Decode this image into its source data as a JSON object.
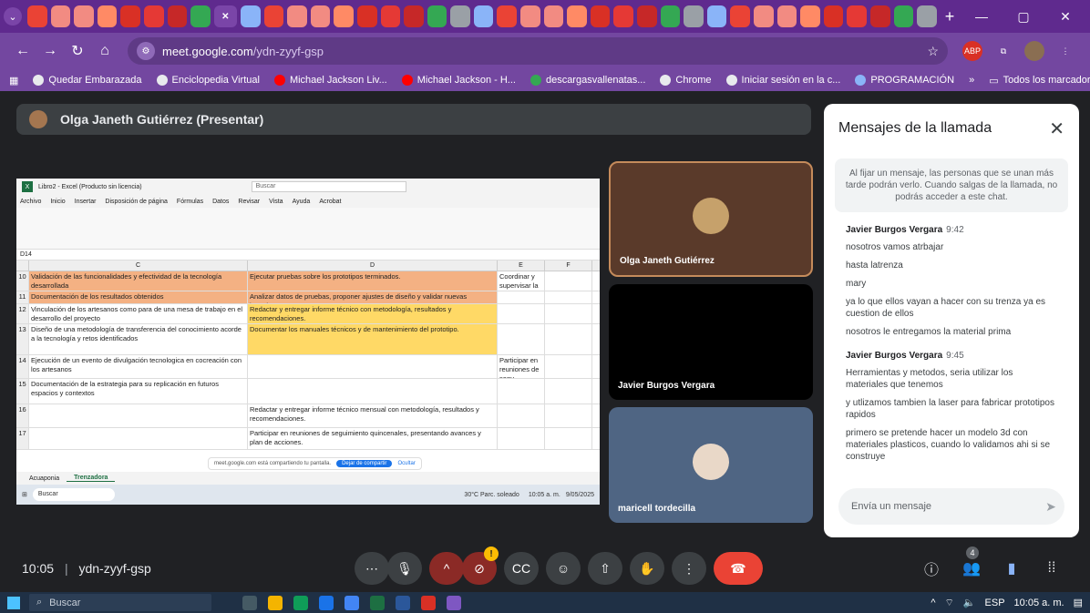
{
  "browser": {
    "url_host": "meet.google.com",
    "url_path": "/ydn-zyyf-gsp",
    "tab_icons": [
      "gmail-icon",
      "arrow-icon",
      "arrow-icon",
      "bookmark-icon",
      "app-icon",
      "pill-icon",
      "youtube-icon",
      "whatsapp-icon",
      "close-icon",
      "chrome-icon",
      "chrome-icon",
      "chrome-icon",
      "meet-icon",
      "chrome-icon",
      "meet-icon",
      "meet-icon",
      "chrome-icon",
      "pen-icon",
      "youtube-icon",
      "puzzle-icon",
      "pen-icon",
      "pen-icon",
      "link-icon",
      "chrome-icon",
      "app-icon",
      "app-icon",
      "app-icon",
      "app-icon",
      "app-icon",
      "chrome-icon",
      "app-icon",
      "app-icon",
      "chrome-icon",
      "heart-icon",
      "chrome-icon",
      "chrome-icon",
      "app-icon",
      "app-icon",
      "chrome-icon"
    ],
    "new_tab": "+",
    "bookmarks": [
      {
        "label": "Quedar Embarazada",
        "color": "#e8eaed"
      },
      {
        "label": "Enciclopedia Virtual",
        "color": "#e8eaed"
      },
      {
        "label": "Michael Jackson Liv...",
        "color": "#ff0000"
      },
      {
        "label": "Michael Jackson - H...",
        "color": "#ff0000"
      },
      {
        "label": "descargasvallenatas...",
        "color": "#34a853"
      },
      {
        "label": "Chrome",
        "color": "#e8eaed"
      },
      {
        "label": "Iniciar sesión en la c...",
        "color": "#e8eaed"
      },
      {
        "label": "PROGRAMACIÓN",
        "color": "#8ab4f8"
      }
    ],
    "bookmarks_more": "»",
    "all_bookmarks": "Todos los marcadores"
  },
  "presenter": {
    "label": "Olga Janeth Gutiérrez (Presentar)"
  },
  "excel": {
    "title": "Libro2 - Excel (Producto sin licencia)",
    "search": "Buscar",
    "menu": [
      "Archivo",
      "Inicio",
      "Insertar",
      "Disposición de página",
      "Fórmulas",
      "Datos",
      "Revisar",
      "Vista",
      "Ayuda",
      "Acrobat"
    ],
    "cell_ref": "D14",
    "col_c": "C",
    "col_d": "D",
    "col_e": "E",
    "col_f": "F",
    "rows": [
      {
        "n": "10",
        "c": "Validación de las funcionalidades y efectividad de la tecnología desarrollada",
        "d": "Ejecutar pruebas sobre los prototipos terminados.",
        "e": "Coordinar y supervisar la fabric."
      },
      {
        "n": "11",
        "c": "Documentación de los resultados obtenidos",
        "d": "Analizar datos de pruebas, proponer ajustes de diseño y validar nuevas iteraciones.",
        "e": ""
      },
      {
        "n": "12",
        "c": "Vinculación de los artesanos como para de una mesa de trabajo en el desarrollo del proyecto",
        "d": "Redactar y entregar informe técnico con metodología, resultados y recomendaciones.",
        "e": ""
      },
      {
        "n": "13",
        "c": "Diseño de una metodología de transferencia del conocimiento acorde a la tecnología y retos identificados",
        "d": "Documentar los manuales técnicos y de mantenimiento del prototipo.",
        "e": ""
      },
      {
        "n": "14",
        "c": "Ejecución de un evento de divulgación tecnologica en cocreación con los artesanos",
        "d": "",
        "e": "Participar en reuniones de segu"
      },
      {
        "n": "15",
        "c": "Documentación de la estrategia para su replicación en futuros espacios y contextos",
        "d": "",
        "e": ""
      },
      {
        "n": "16",
        "c": "",
        "d": "Redactar y entregar informe técnico mensual con metodología, resultados y recomendaciones.",
        "e": ""
      },
      {
        "n": "17",
        "c": "",
        "d": "Participar en reuniones de seguimiento quincenales, presentando avances y plan de acciones.",
        "e": ""
      }
    ],
    "sheets": [
      "Acuaponia",
      "Trenzadora"
    ],
    "share_text": "meet.google.com está compartiendo tu pantalla.",
    "stop_share": "Dejar de compartir",
    "hide": "Ocultar",
    "taskbar_search": "Buscar",
    "weather": "30°C Parc. soleado",
    "clock": "10:05 a. m.",
    "date": "9/05/2025"
  },
  "tiles": [
    {
      "name": "Olga Janeth Gutiérrez"
    },
    {
      "name": "Javier Burgos Vergara"
    },
    {
      "name": "maricell tordecilla"
    }
  ],
  "chat": {
    "title": "Mensajes de la llamada",
    "note": "Al fijar un mensaje, las personas que se unan más tarde podrán verlo. Cuando salgas de la llamada, no podrás acceder a este chat.",
    "groups": [
      {
        "sender": "Javier Burgos Vergara",
        "time": "9:42",
        "lines": [
          "nosotros vamos atrbajar",
          "hasta latrenza",
          "mary",
          "ya lo que ellos vayan a hacer con su trenza ya es cuestion de ellos",
          "nosotros le entregamos la material prima"
        ]
      },
      {
        "sender": "Javier Burgos Vergara",
        "time": "9:45",
        "lines": [
          "Herramientas y metodos, seria utilizar los materiales que tenemos",
          "y utlizamos tambien la laser para fabricar prototipos rapidos",
          "primero se pretende hacer un modelo 3d con materiales plasticos, cuando lo validamos ahi si se construye"
        ]
      }
    ],
    "input_placeholder": "Envía un mensaje"
  },
  "meet": {
    "time": "10:05",
    "code": "ydn-zyyf-gsp",
    "separator": "|",
    "people_count": "4",
    "alert_badge": "!"
  },
  "taskbar": {
    "search": "Buscar",
    "lang": "ESP",
    "clock": "10:05 a. m."
  }
}
